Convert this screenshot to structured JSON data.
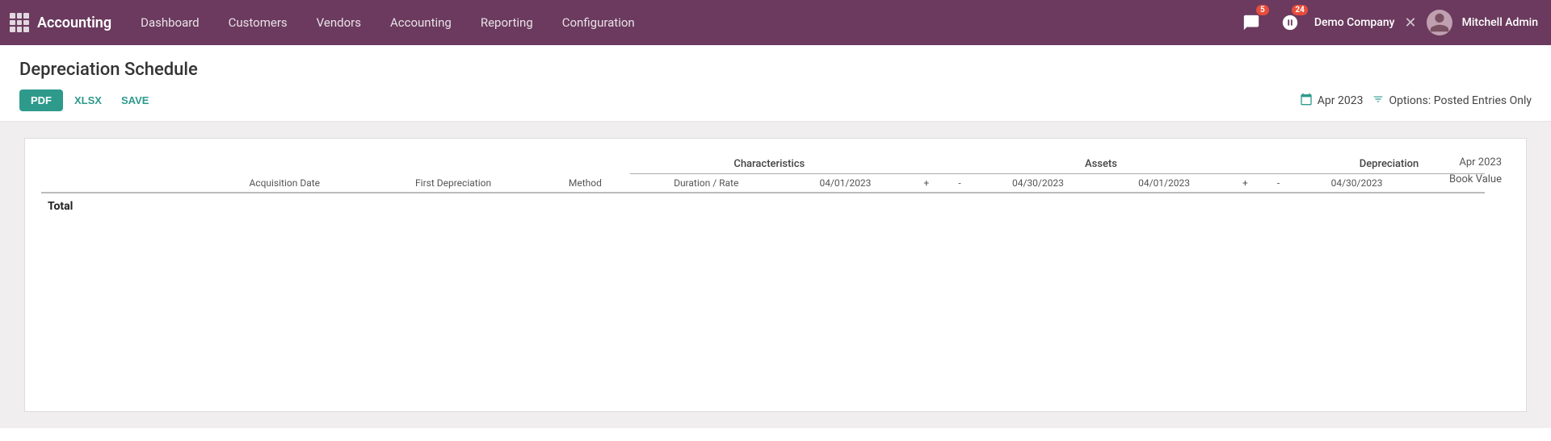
{
  "navbar": {
    "brand": "Accounting",
    "links": [
      "Dashboard",
      "Customers",
      "Vendors",
      "Accounting",
      "Reporting",
      "Configuration"
    ],
    "messages_badge": "5",
    "activity_badge": "24",
    "company": "Demo Company",
    "user": "Mitchell Admin"
  },
  "page": {
    "title": "Depreciation Schedule",
    "buttons": {
      "pdf": "PDF",
      "xlsx": "XLSX",
      "save": "SAVE"
    },
    "date_filter": "Apr 2023",
    "options_filter": "Options: Posted Entries Only"
  },
  "table": {
    "top_right_line1": "Apr 2023",
    "top_right_line2": "Book Value",
    "section_characteristics": "Characteristics",
    "section_assets": "Assets",
    "section_depreciation": "Depreciation",
    "columns": [
      "Acquisition Date",
      "First Depreciation",
      "Method",
      "Duration / Rate",
      "04/01/2023",
      "+",
      "-",
      "04/30/2023",
      "04/01/2023",
      "+",
      "-",
      "04/30/2023"
    ],
    "total_label": "Total"
  }
}
